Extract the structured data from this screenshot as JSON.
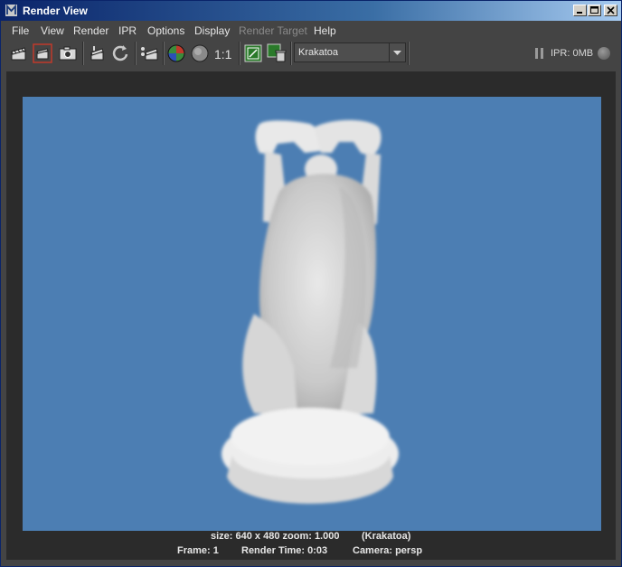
{
  "window": {
    "title": "Render View"
  },
  "menu": {
    "items": [
      {
        "label": "File",
        "disabled": false
      },
      {
        "label": "View",
        "disabled": false
      },
      {
        "label": "Render",
        "disabled": false
      },
      {
        "label": "IPR",
        "disabled": false
      },
      {
        "label": "Options",
        "disabled": false
      },
      {
        "label": "Display",
        "disabled": false
      },
      {
        "label": "Render Target",
        "disabled": true
      },
      {
        "label": "Help",
        "disabled": false
      }
    ]
  },
  "toolbar": {
    "icons": [
      "redo-render-icon",
      "render-region-icon",
      "snapshot-icon",
      "ipr-render-icon",
      "refresh-ipr-icon",
      "render-settings-icon",
      "rgb-channels-icon",
      "alpha-channel-icon",
      "stereo-icon",
      "keep-image-icon",
      "remove-image-icon"
    ],
    "ratio_label": "1:1",
    "renderer_select": "Krakatoa",
    "ipr_memory": "IPR: 0MB"
  },
  "status": {
    "line1_size": "size: 640 x 480 zoom: 1.000",
    "line1_renderer": "(Krakatoa)",
    "line2_frame": "Frame: 1",
    "line2_time": "Render Time: 0:03",
    "line2_camera": "Camera: persp"
  },
  "colors": {
    "title_bar": "#0a246a",
    "background": "#444444",
    "render_background": "#4c7eb3"
  }
}
